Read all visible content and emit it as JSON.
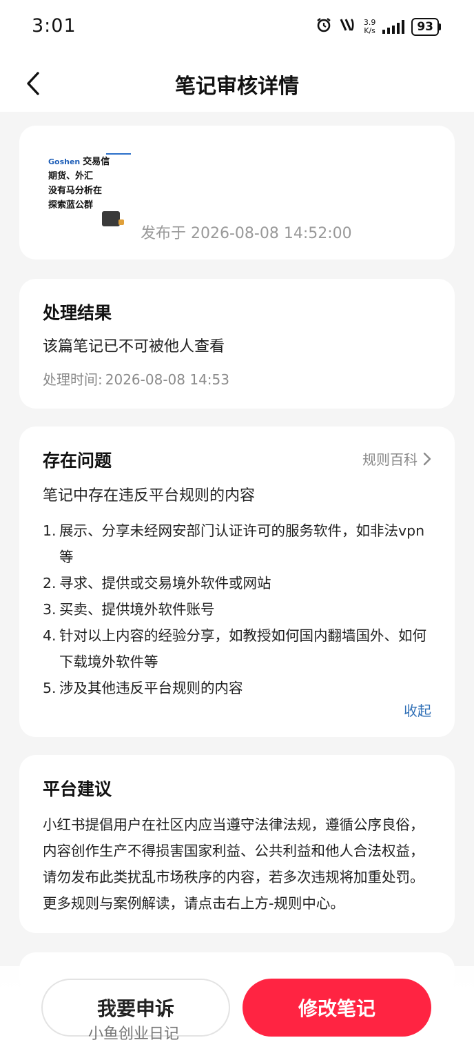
{
  "status_bar": {
    "time": "3:01",
    "net_speed_value": "3.9",
    "net_speed_unit": "K/s",
    "battery": "93"
  },
  "nav": {
    "title": "笔记审核详情"
  },
  "note": {
    "thumbnail_lines": [
      "交易信",
      "期货、外汇",
      "没有马分析在",
      "探索蓝公群"
    ],
    "thumbnail_brand_en": "Goshen",
    "publish_time": "发布于 2026-08-08 14:52:00"
  },
  "result": {
    "title": "处理结果",
    "description": "该篇笔记已不可被他人查看",
    "time_label": "处理时间:",
    "time_value": "2026-08-08 14:53"
  },
  "issue": {
    "title": "存在问题",
    "rules_link": "规则百科",
    "summary": "笔记中存在违反平台规则的内容",
    "items": [
      {
        "num": "1.",
        "text": "展示、分享未经网安部门认证许可的服务软件，如非法vpn等"
      },
      {
        "num": "2.",
        "text": "寻求、提供或交易境外软件或网站"
      },
      {
        "num": "3.",
        "text": "买卖、提供境外软件账号"
      },
      {
        "num": "4.",
        "text": "针对以上内容的经验分享，如教授如何国内翻墙国外、如何下载境外软件等"
      },
      {
        "num": "5.",
        "text": "涉及其他违反平台规则的内容"
      }
    ],
    "collapse": "收起"
  },
  "advice": {
    "title": "平台建议",
    "body": "小红书提倡用户在社区内应当遵守法律法规，遵循公序良俗，内容创作生产不得损害国家利益、公共利益和他人合法权益，请勿发布此类扰乱市场秩序的内容，若多次违规将加重处罚。更多规则与案例解读，请点击右上方-规则中心。"
  },
  "actions": {
    "appeal": "我要申诉",
    "edit": "修改笔记"
  },
  "watermark": "小鱼创业日记",
  "colors": {
    "primary": "#ff2442",
    "link": "#2f6fb6",
    "background": "#f5f5f5"
  }
}
